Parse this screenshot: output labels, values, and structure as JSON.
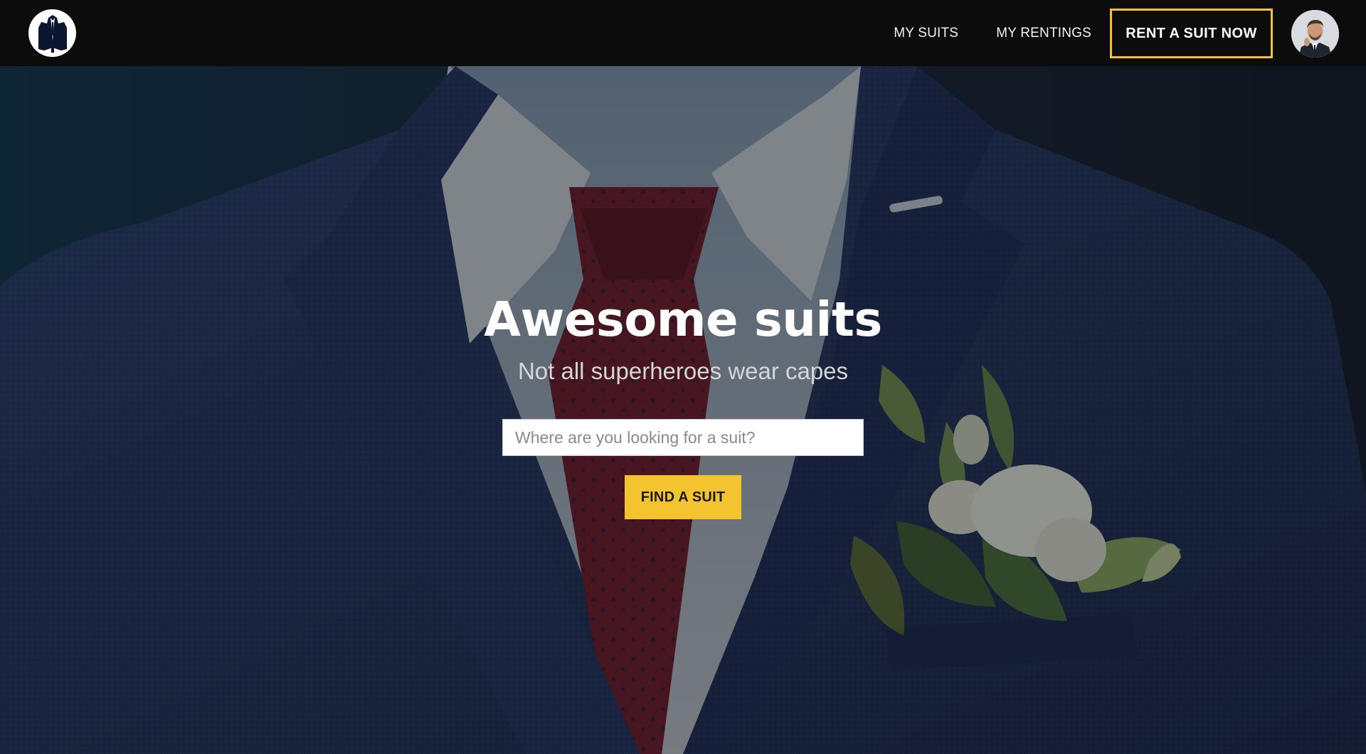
{
  "navbar": {
    "logo_icon": "suit-jacket-icon",
    "links": [
      {
        "label": "MY SUITS"
      },
      {
        "label": "MY RENTINGS"
      }
    ],
    "cta_label": "RENT A SUIT NOW",
    "avatar_icon": "user-avatar"
  },
  "hero": {
    "background": "suit-with-red-tie-and-boutonniere-photo",
    "title": "Awesome suits",
    "subtitle": "Not all superheroes wear capes",
    "search": {
      "placeholder": "Where are you looking for a suit?",
      "value": ""
    },
    "button_label": "FIND A SUIT"
  },
  "colors": {
    "accent": "#f3c42f",
    "navbar_bg": "#0c0c0c",
    "suit_navy": "#1f2c4e",
    "tie_red": "#6a1a24"
  }
}
